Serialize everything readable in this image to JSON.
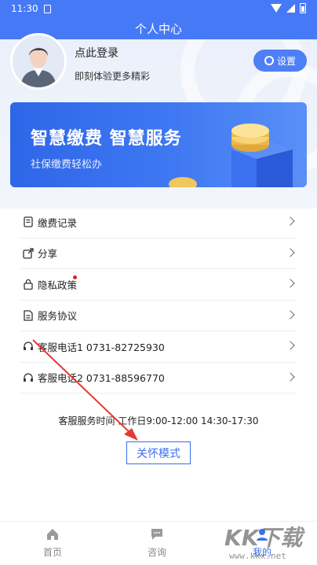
{
  "status_bar": {
    "time": "11:30",
    "icons": [
      "sim-card-icon",
      "wifi-icon",
      "signal-icon",
      "battery-icon"
    ]
  },
  "navbar": {
    "title": "个人中心"
  },
  "profile": {
    "login_title": "点此登录",
    "login_sub": "即刻体验更多精彩",
    "settings_label": "设置"
  },
  "banner": {
    "title": "智慧缴费  智慧服务",
    "subtitle": "社保缴费轻松办"
  },
  "menu": {
    "items": [
      {
        "label": "缴费记录",
        "icon": "receipt-icon"
      },
      {
        "label": "分享",
        "icon": "share-icon"
      },
      {
        "label": "隐私政策",
        "icon": "lock-icon"
      },
      {
        "label": "服务协议",
        "icon": "document-icon"
      },
      {
        "label": "客服电话1 0731-82725930",
        "icon": "headset-icon"
      },
      {
        "label": "客服电话2 0731-88596770",
        "icon": "headset-icon"
      }
    ]
  },
  "service_time": "客服服务时间 工作日9:00-12:00 14:30-17:30",
  "care_mode": "关怀模式",
  "tabbar": {
    "tabs": [
      {
        "label": "首页",
        "icon": "home-icon"
      },
      {
        "label": "咨询",
        "icon": "chat-icon"
      },
      {
        "label": "我的",
        "icon": "user-icon",
        "active": true
      }
    ]
  },
  "watermark": {
    "text": "KK下载",
    "url": "www.kkx.net"
  },
  "colors": {
    "primary": "#4679f5",
    "accent": "#3a6ff0",
    "annotation": "#e53935"
  }
}
